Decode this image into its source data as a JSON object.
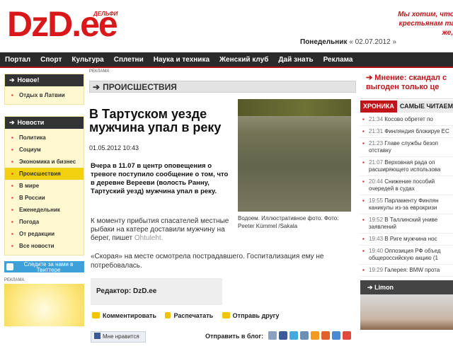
{
  "header": {
    "logo": "DzD.ee",
    "logo_badge": "ДЕЛЬФИ",
    "day": "Понедельник",
    "date": "« 02.07.2012 »",
    "promo": "Мы хотим, чтоб крестьянам так же, к"
  },
  "nav": {
    "items": [
      "Портал",
      "Спорт",
      "Культура",
      "Сплетни",
      "Наука и техника",
      "Женский клуб",
      "Дай знать",
      "Реклама"
    ]
  },
  "sidebar": {
    "new_box": {
      "title": "Новое!",
      "items": [
        "Отдых в Латвии"
      ]
    },
    "news_box": {
      "title": "Новости",
      "items": [
        "Политика",
        "Социум",
        "Экономика и бизнес",
        "Происшествия",
        "В мире",
        "В России",
        "Еженедельник",
        "Погода",
        "От редакции",
        "Все новости"
      ],
      "active_index": 3
    },
    "twitter": "Следите за нами в Твиттере",
    "ad_label": "РЕКЛАМА"
  },
  "main": {
    "ad_label": "РЕКЛАМА",
    "category": "ПРОИСШЕСТВИЯ",
    "title": "В Тартуском уезде мужчина упал в реку",
    "date": "01.05.2012 10:43",
    "lead": "Вчера в 11.07 в центр оповещения о тревоге поступило сообщение о том, что в деревне Верееви (волость Ранну, Тартуский уезд) мужчина упал в реку.",
    "body1": "К моменту прибытия спасателей местные рыбаки на катере доставили мужчину на берег, пишет ",
    "body1_source": "Ohtuleht.",
    "body2": "«Скорая» на месте осмотрела пострадавшего. Госпитализация ему не потребовалась.",
    "photo_caption": "Водоем. Иллюстративное фото. Фото: Peeter Kümmel /Sakala",
    "editor": "Редактор: DzD.ee",
    "actions": {
      "comment": "Комментировать",
      "print": "Распечатать",
      "send": "Отправь другу"
    },
    "like": "Мне нравится",
    "blog_label": "Отправить в блог:"
  },
  "right": {
    "opinion": "Мнение: скандал с выгоден только це",
    "tabs": [
      "ХРОНИКА",
      "САМЫЕ ЧИТАЕМ"
    ],
    "news": [
      {
        "time": "21:34",
        "text": "Косово обретет по"
      },
      {
        "time": "21:31",
        "text": "Финляндия блокируе ЕС"
      },
      {
        "time": "21:23",
        "text": "Главе службы безоп отставку"
      },
      {
        "time": "21:07",
        "text": "Верховная рада оп расширяющего использова"
      },
      {
        "time": "20:44",
        "text": "Снижение пособий очередей в судах"
      },
      {
        "time": "19:55",
        "text": "Парламенту Финлян каникулы из-за еврокризи"
      },
      {
        "time": "19:52",
        "text": "В Таллинский униве заявлений"
      },
      {
        "time": "19:43",
        "text": "В Риге мужчина нос"
      },
      {
        "time": "19:40",
        "text": "Оппозиция РФ объед общероссийскую акцию (1"
      },
      {
        "time": "19:29",
        "text": "Галерея: BMW прота"
      }
    ],
    "limon": "Limon"
  }
}
